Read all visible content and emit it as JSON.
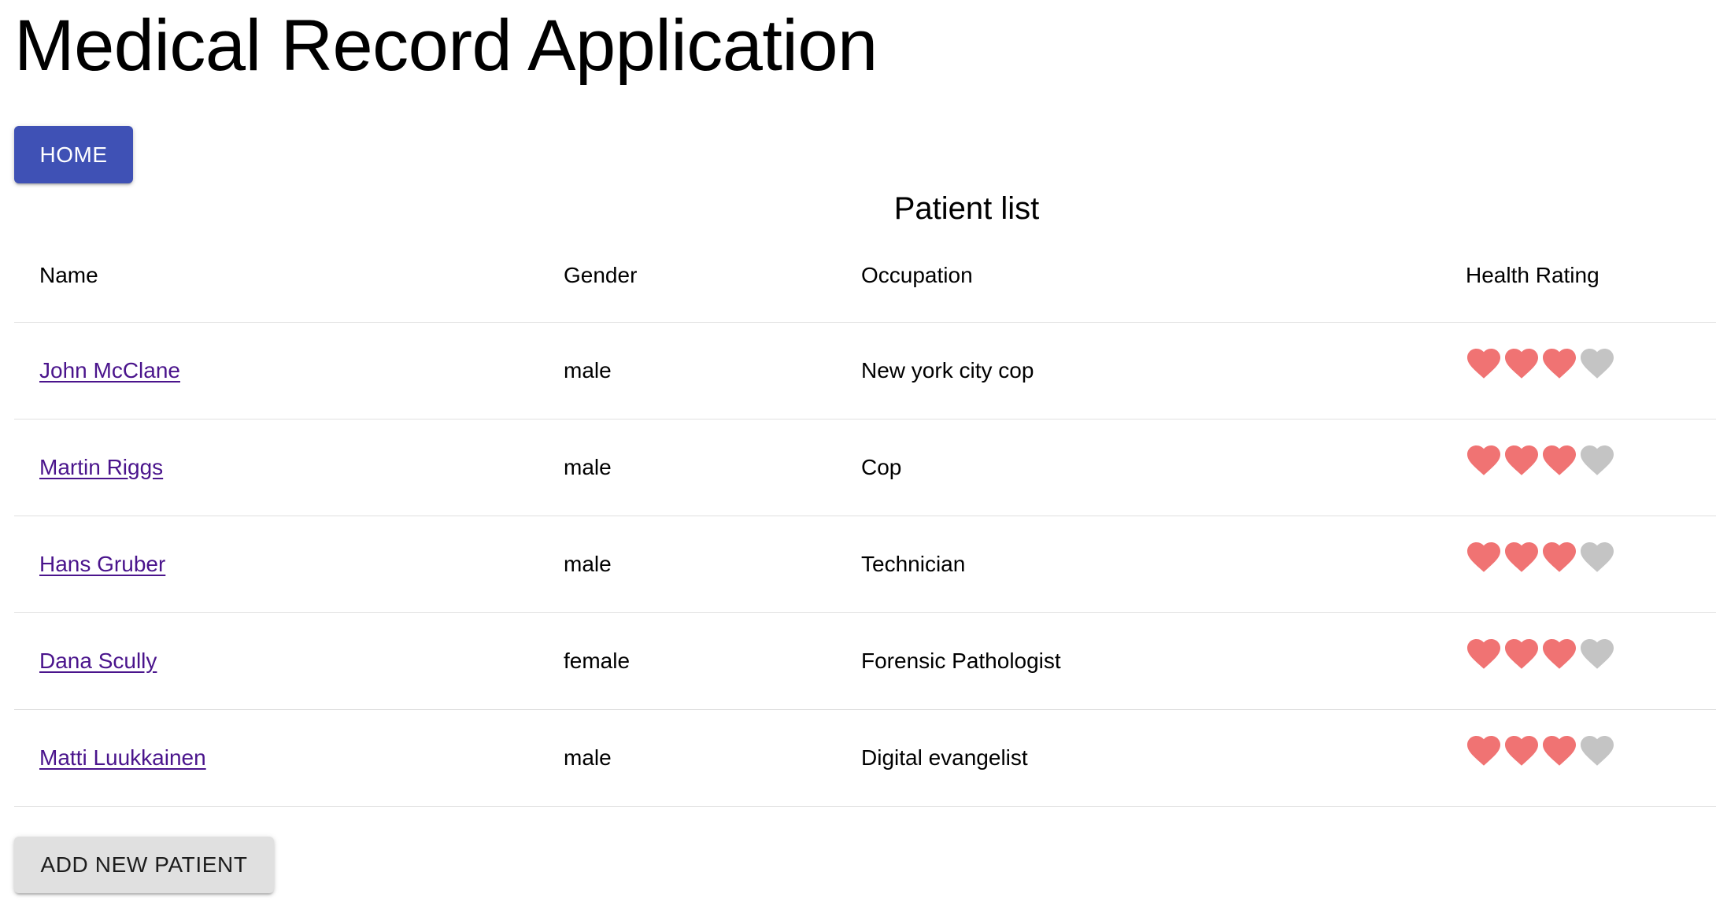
{
  "app": {
    "title": "Medical Record Application"
  },
  "nav": {
    "home_label": "HOME"
  },
  "patient_list": {
    "title": "Patient list",
    "columns": [
      "Name",
      "Gender",
      "Occupation",
      "Health Rating"
    ],
    "rating_max": 4,
    "colors": {
      "heart_filled": "#f07373",
      "heart_empty": "#c4c4c4",
      "link": "#4a148c"
    },
    "icons": {
      "filled": "heart-filled-icon",
      "empty": "heart-empty-icon"
    },
    "rows": [
      {
        "name": "John McClane",
        "gender": "male",
        "occupation": "New york city cop",
        "rating": 3
      },
      {
        "name": "Martin Riggs",
        "gender": "male",
        "occupation": "Cop",
        "rating": 3
      },
      {
        "name": "Hans Gruber",
        "gender": "male",
        "occupation": "Technician",
        "rating": 3
      },
      {
        "name": "Dana Scully",
        "gender": "female",
        "occupation": "Forensic Pathologist",
        "rating": 3
      },
      {
        "name": "Matti Luukkainen",
        "gender": "male",
        "occupation": "Digital evangelist",
        "rating": 3
      }
    ]
  },
  "actions": {
    "add_patient_label": "ADD NEW PATIENT"
  }
}
